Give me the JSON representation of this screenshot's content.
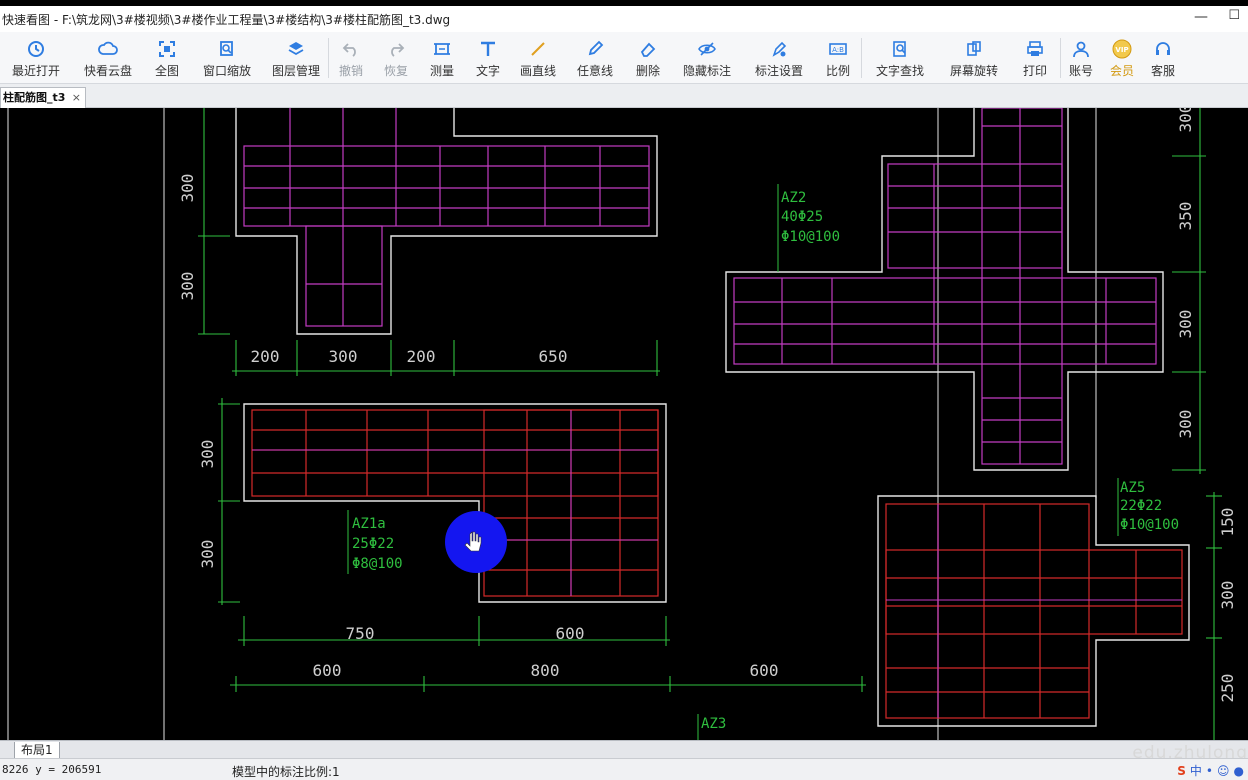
{
  "window": {
    "title": "快速看图 - F:\\筑龙网\\3#楼视频\\3#楼作业工程量\\3#楼结构\\3#楼柱配筋图_t3.dwg",
    "min_glyph": "—",
    "max_glyph": "☐"
  },
  "toolbar": {
    "items": [
      {
        "id": "recent-open",
        "label": "最近打开",
        "icon": "clock-icon"
      },
      {
        "id": "cloud",
        "label": "快看云盘",
        "icon": "cloud-icon"
      },
      {
        "id": "full-view",
        "label": "全图",
        "icon": "fullscreen-icon"
      },
      {
        "id": "window-zoom",
        "label": "窗口缩放",
        "icon": "zoom-window-icon"
      },
      {
        "id": "layer-manage",
        "label": "图层管理",
        "icon": "layers-icon"
      },
      {
        "id": "undo",
        "label": "撤销",
        "icon": "undo-icon",
        "disabled": true
      },
      {
        "id": "redo",
        "label": "恢复",
        "icon": "redo-icon",
        "disabled": true
      },
      {
        "id": "measure",
        "label": "测量",
        "icon": "measure-icon"
      },
      {
        "id": "text",
        "label": "文字",
        "icon": "text-icon"
      },
      {
        "id": "draw-line",
        "label": "画直线",
        "icon": "line-icon"
      },
      {
        "id": "freehand",
        "label": "任意线",
        "icon": "pen-icon"
      },
      {
        "id": "delete",
        "label": "删除",
        "icon": "eraser-icon"
      },
      {
        "id": "hide-annot",
        "label": "隐藏标注",
        "icon": "eye-slash-icon"
      },
      {
        "id": "annot-settings",
        "label": "标注设置",
        "icon": "annot-settings-icon"
      },
      {
        "id": "ratio",
        "label": "比例",
        "icon": "ratio-icon"
      },
      {
        "id": "text-search",
        "label": "文字查找",
        "icon": "text-search-icon"
      },
      {
        "id": "rotate-screen",
        "label": "屏幕旋转",
        "icon": "rotate-icon"
      },
      {
        "id": "print",
        "label": "打印",
        "icon": "printer-icon"
      },
      {
        "id": "account",
        "label": "账号",
        "icon": "user-icon"
      },
      {
        "id": "vip",
        "label": "会员",
        "icon": "vip-icon"
      },
      {
        "id": "service",
        "label": "客服",
        "icon": "headset-icon"
      }
    ]
  },
  "doc_tab": {
    "label": "柱配筋图_t3",
    "close": "×"
  },
  "drawing": {
    "dims": {
      "top_v1": "300",
      "top_v2": "300",
      "top_h1": "200",
      "top_h2": "300",
      "top_h3": "200",
      "top_h4": "650",
      "mid_v1": "300",
      "mid_v2": "300",
      "mid_h1": "750",
      "mid_h2": "600",
      "bot_h1": "600",
      "bot_h2": "800",
      "bot_h3": "600",
      "right_v1": "300",
      "right_v2": "350",
      "right_v3": "300",
      "right_v4": "300",
      "right_v5": "150",
      "right_v6": "300",
      "right_v7": "250"
    },
    "labels": {
      "az2": [
        "AZ2",
        "40Φ25",
        "Φ10@100"
      ],
      "az1a": [
        "AZ1a",
        "25Φ22",
        "Φ8@100"
      ],
      "az5": [
        "AZ5",
        "22Φ22",
        "Φ10@100"
      ],
      "az3": [
        "AZ3"
      ]
    },
    "colors": {
      "outline": "#e6e6e6",
      "magenta": "#c33cc3",
      "red": "#d42a2a",
      "green": "#2fbf3f",
      "cursor": "#1416f0"
    }
  },
  "layout_tab": "布局1",
  "watermark": "edu.zhulong",
  "status": {
    "coords": "8226 y = 206591",
    "scale_text": "模型中的标注比例:1"
  }
}
